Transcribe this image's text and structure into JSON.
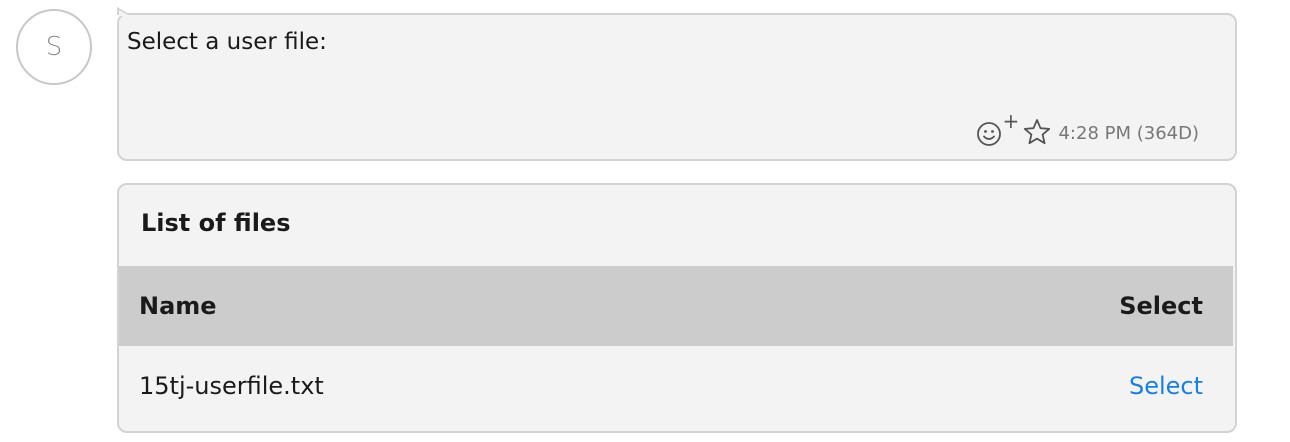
{
  "sender": {
    "avatar_initial": "S"
  },
  "message": {
    "text": "Select a user file:",
    "timestamp": "4:28 PM (364D)",
    "react_icon": "emoji-add-icon",
    "star_icon": "star-outline-icon"
  },
  "files_card": {
    "title": "List of files",
    "columns": {
      "name": "Name",
      "select": "Select"
    },
    "rows": [
      {
        "name": "15tj-userfile.txt",
        "action": "Select"
      }
    ],
    "colors": {
      "header_bg": "#cccccc",
      "link": "#1b7fe0"
    }
  },
  "colors": {
    "bubble_bg": "#f3f3f3",
    "bubble_border": "#d3d3d3"
  }
}
